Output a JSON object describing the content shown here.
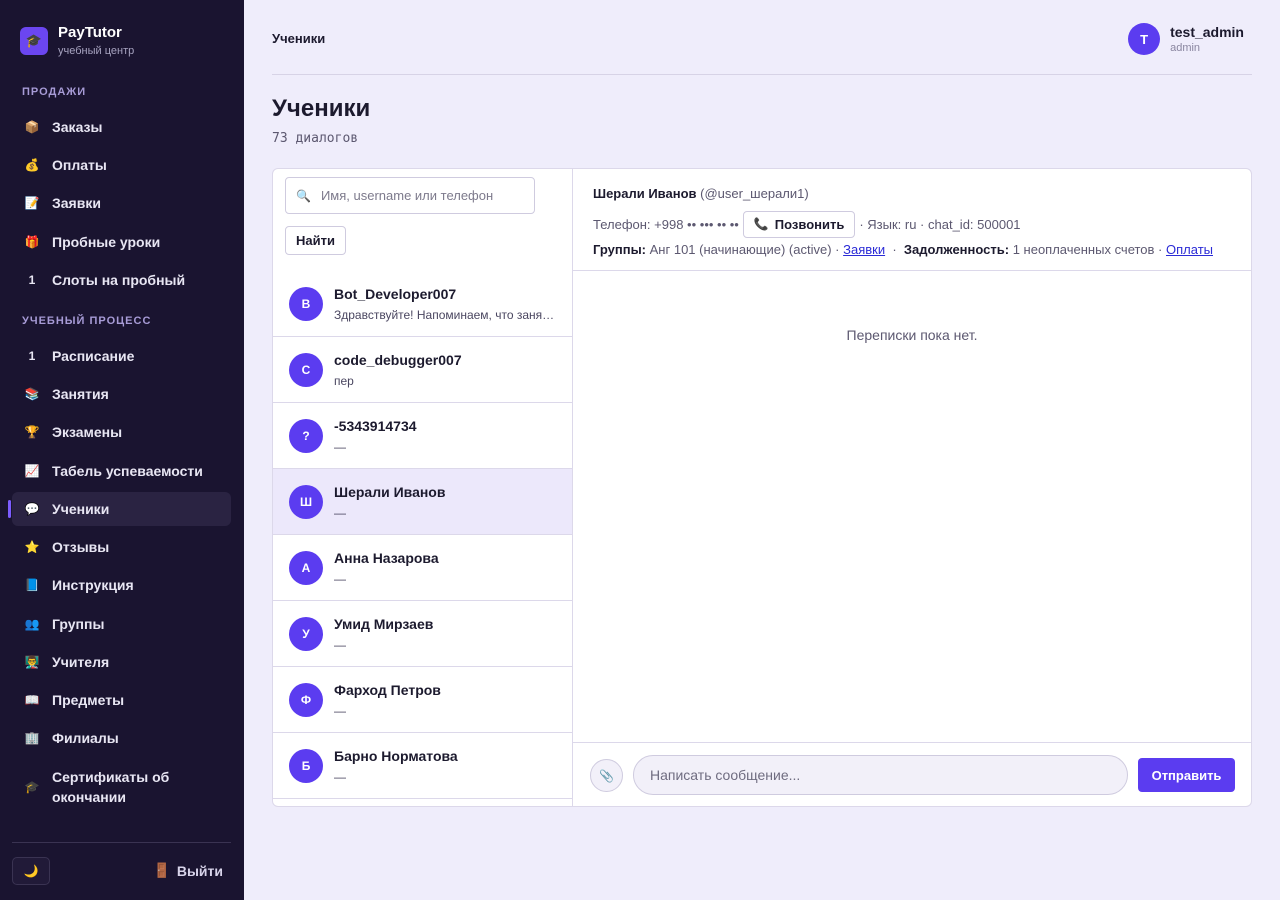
{
  "brand": {
    "title": "PayTutor",
    "subtitle": "учебный центр",
    "logo_icon": "graduation-cap-icon"
  },
  "sidebar": {
    "sections": [
      {
        "label": "ПРОДАЖИ"
      },
      {
        "label": "УЧЕБНЫЙ ПРОЦЕСС"
      }
    ],
    "items": [
      {
        "label": "Заказы",
        "icon": "📦"
      },
      {
        "label": "Оплаты",
        "icon": "💰"
      },
      {
        "label": "Заявки",
        "icon": "📝"
      },
      {
        "label": "Пробные уроки",
        "icon": "🎁"
      },
      {
        "label": "Слоты на пробный",
        "icon": "1"
      },
      {
        "label": "Расписание",
        "icon": "1"
      },
      {
        "label": "Занятия",
        "icon": "📚"
      },
      {
        "label": "Экзамены",
        "icon": "🏆"
      },
      {
        "label": "Табель успеваемости",
        "icon": "📈"
      },
      {
        "label": "Ученики",
        "icon": "💬",
        "active": true
      },
      {
        "label": "Отзывы",
        "icon": "⭐"
      },
      {
        "label": "Инструкция",
        "icon": "📘"
      },
      {
        "label": "Группы",
        "icon": "👥"
      },
      {
        "label": "Учителя",
        "icon": "👨‍🏫"
      },
      {
        "label": "Предметы",
        "icon": "📖"
      },
      {
        "label": "Филиалы",
        "icon": "🏢"
      },
      {
        "label": "Сертификаты об окончании",
        "icon": "🎓"
      }
    ],
    "theme_icon": "🌙",
    "logout_label": "Выйти",
    "logout_icon": "🚪"
  },
  "header": {
    "breadcrumb": "Ученики",
    "user": {
      "initial": "T",
      "name": "test_admin",
      "role": "admin"
    }
  },
  "page": {
    "title": "Ученики",
    "subtitle": "73 диалогов"
  },
  "search": {
    "placeholder": "Имя, username или телефон",
    "button": "Найти",
    "icon": "🔍"
  },
  "dialogs": [
    {
      "initial": "B",
      "name": "Bot_Developer007",
      "preview": "Здравствуйте! Напоминаем, что занятие"
    },
    {
      "initial": "C",
      "name": "code_debugger007",
      "preview": "пер"
    },
    {
      "initial": "?",
      "name": "-5343914734",
      "preview": "—"
    },
    {
      "initial": "Ш",
      "name": "Шерали Иванов",
      "preview": "—",
      "selected": true
    },
    {
      "initial": "А",
      "name": "Анна Назарова",
      "preview": "—"
    },
    {
      "initial": "У",
      "name": "Умид Мирзаев",
      "preview": "—"
    },
    {
      "initial": "Ф",
      "name": "Фарход Петров",
      "preview": "—"
    },
    {
      "initial": "Б",
      "name": "Барно Норматова",
      "preview": "—"
    }
  ],
  "chat": {
    "name": "Шерали Иванов",
    "username": "(@user_шерали1)",
    "phone_label": "Телефон: +998 •• ••• •• ••",
    "call_label": "Позвонить",
    "call_icon": "📞",
    "lang_chat": "· Язык: ru · chat_id: 500001",
    "groups_label": "Группы:",
    "groups_value": "Анг 101 (начинающие) (active) ·",
    "requests_link": "Заявки",
    "debt_label": "Задолженность:",
    "debt_value": "1 неоплаченных счетов ·",
    "payments_link": "Оплаты",
    "empty_text": "Переписки пока нет.",
    "composer_placeholder": "Написать сообщение...",
    "send_label": "Отправить",
    "attach_icon": "📎"
  }
}
